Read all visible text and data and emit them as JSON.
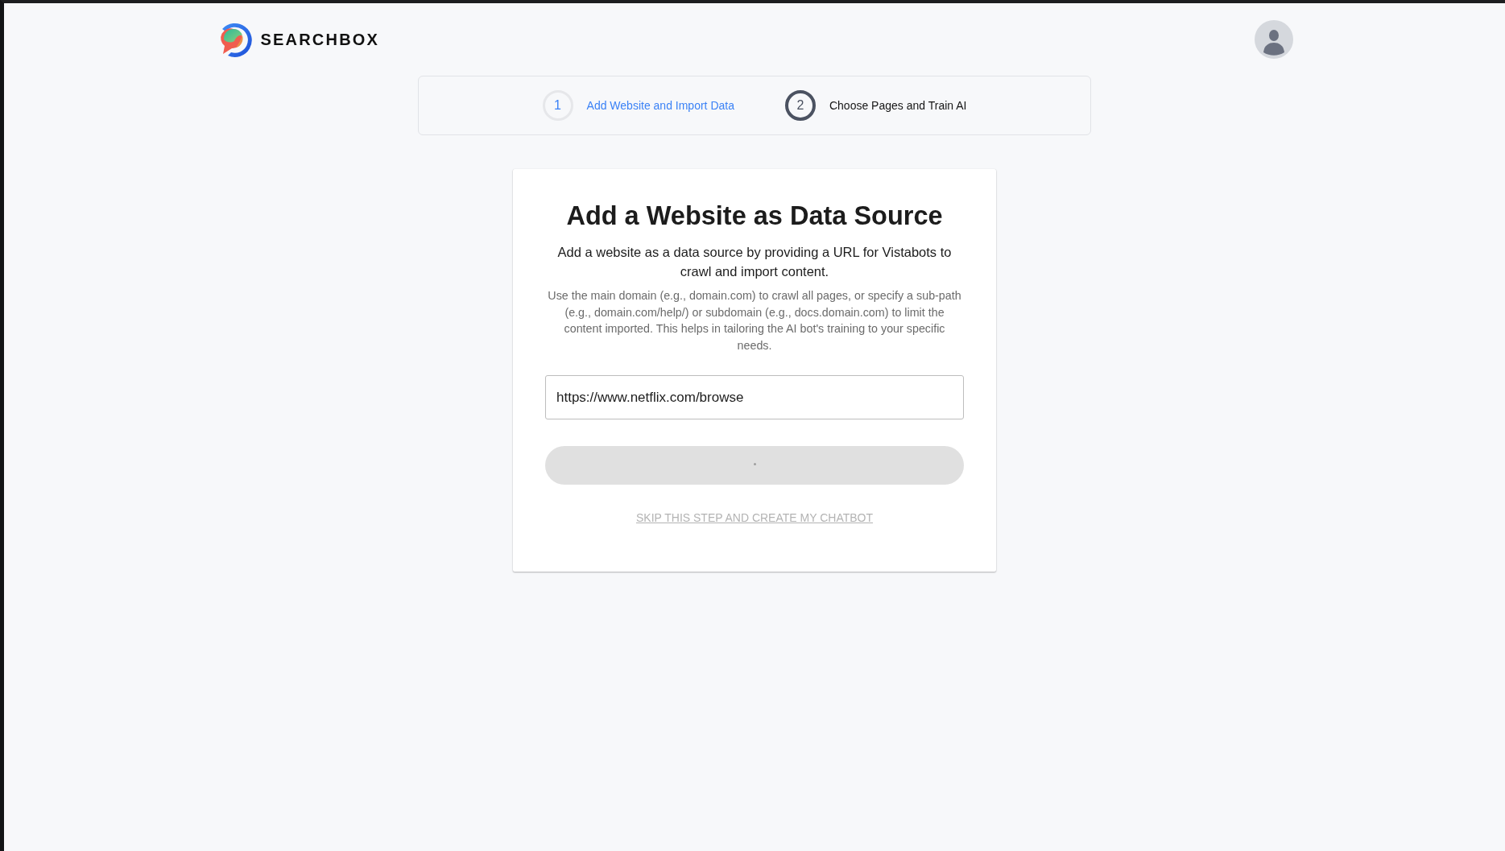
{
  "header": {
    "logo_text": "SEARCHBOX"
  },
  "steps": [
    {
      "number": "1",
      "label": "Add Website and Import Data",
      "selected": true
    },
    {
      "number": "2",
      "label": "Choose Pages and Train AI",
      "selected": false
    }
  ],
  "card": {
    "title": "Add a Website as Data Source",
    "subtitle": "Add a website as a data source by providing a URL for Vistabots to crawl and import content.",
    "description": "Use the main domain (e.g., domain.com) to crawl all pages, or specify a sub-path (e.g., domain.com/help/) or subdomain (e.g., docs.domain.com) to limit the content imported. This helps in tailoring the AI bot's training to your specific needs.",
    "url_field": {
      "value": "https://www.netflix.com/browse"
    },
    "submit_button": {
      "disabled": true,
      "loading": true
    },
    "skip_link": "SKIP THIS STEP AND CREATE MY CHATBOT"
  }
}
